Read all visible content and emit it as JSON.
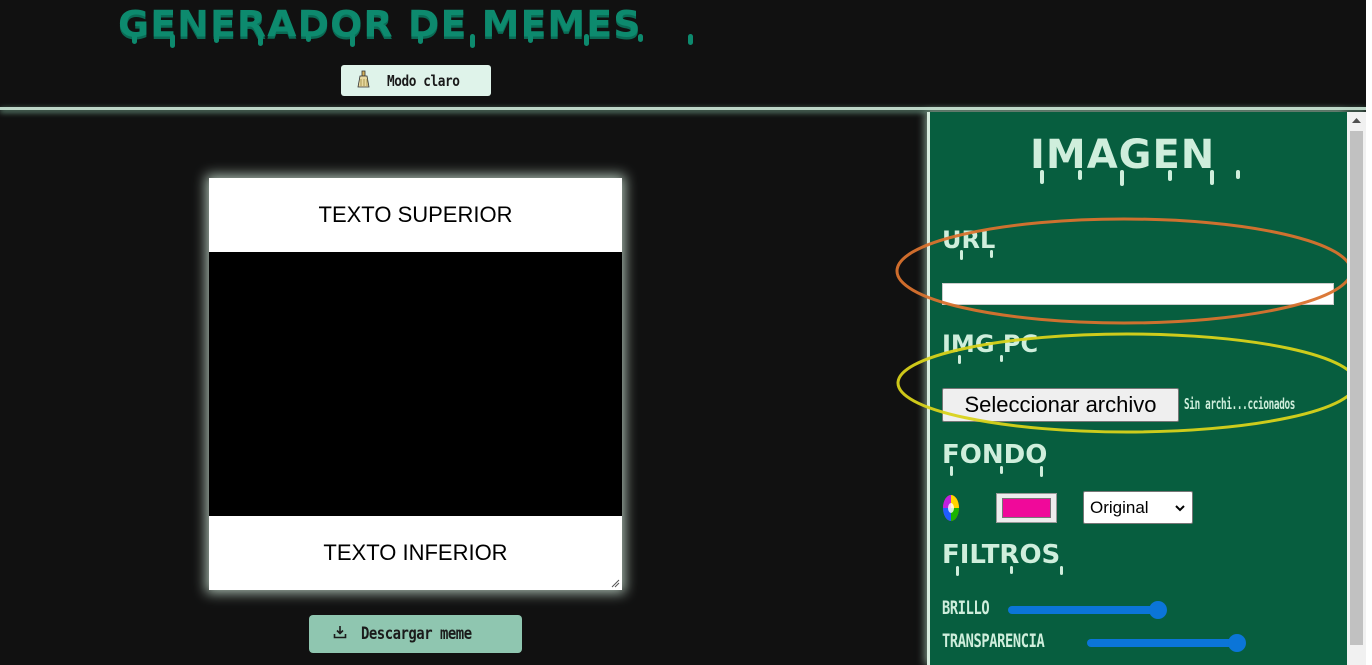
{
  "header": {
    "title": "GENERADOR DE MEMES",
    "mode_button_label": "Modo claro",
    "mode_icon": "broom-icon"
  },
  "meme": {
    "top_text": "TEXTO SUPERIOR",
    "bottom_text": "TEXTO INFERIOR",
    "image_background": "#000000"
  },
  "download": {
    "label": "Descargar meme",
    "icon": "download-icon"
  },
  "panel": {
    "title": "IMAGEN",
    "url_heading": "URL",
    "url_value": "",
    "img_pc_heading": "IMG PC",
    "file_button_label": "Seleccionar archivo",
    "file_status": "Sin archi...ccionados",
    "fondo_heading": "FONDO",
    "color_value": "#f0099a",
    "blend_select_value": "Original",
    "filtros_heading": "FILTROS",
    "sliders": [
      {
        "label": "BRILLO",
        "value": 1.0
      },
      {
        "label": "TRANSPARENCIA",
        "value": 1.0
      }
    ]
  },
  "colors": {
    "page_background": "#111111",
    "title_color": "#0d8a6e",
    "panel_background": "#075e3f",
    "panel_text": "#cfeedc",
    "accent_blue": "#0b75d8",
    "download_button": "#8fc6b0"
  }
}
